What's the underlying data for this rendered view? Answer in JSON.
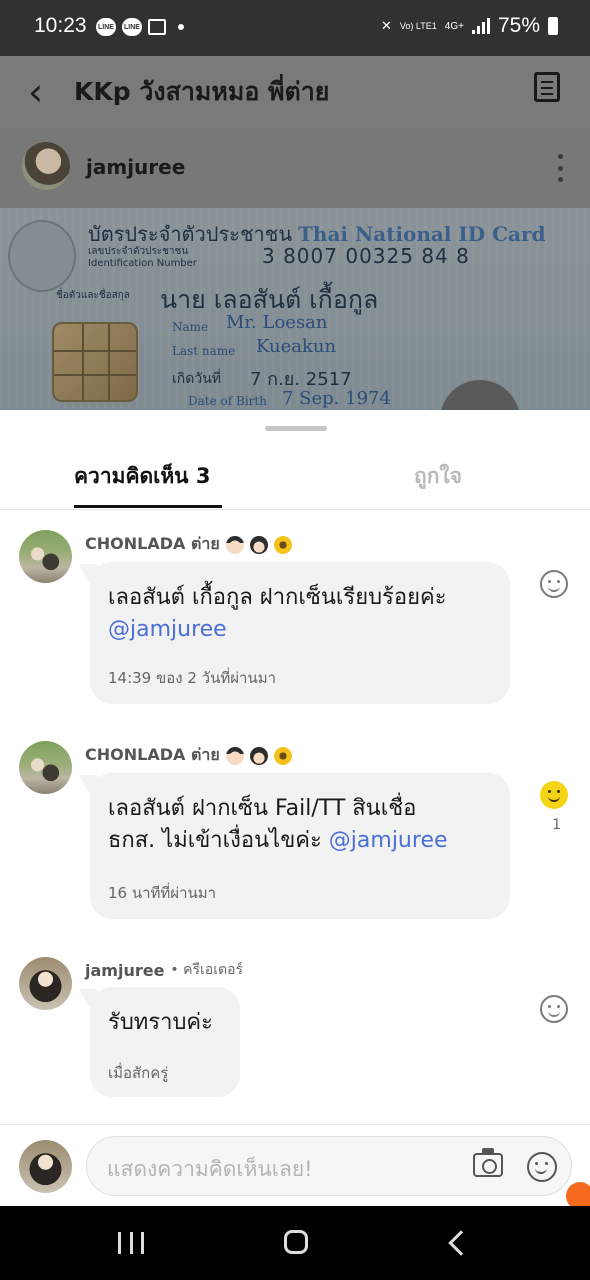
{
  "status_bar": {
    "time": "10:23",
    "notification_icons": [
      "LINE",
      "LINE"
    ],
    "network_label": "Vo) LTE1",
    "network_type": "4G+",
    "battery": "75%"
  },
  "header": {
    "title": "KKp วังสามหมอ พี่ต่าย"
  },
  "post": {
    "username": "jamjuree"
  },
  "id_card": {
    "title_th": "บัตรประจำตัวประชาชน",
    "title_en": "Thai National ID Card",
    "id_label_th": "เลขประจำตัวประชาชน",
    "id_label_en": "Identification Number",
    "id_number": "3 8007 00325 84 8",
    "name_label_th": "ชื่อตัวและชื่อสกุล",
    "name_th": "นาย เลอสันต์ เกื้อกูล",
    "name_label_en": "Name",
    "name_en": "Mr. Loesan",
    "lastname_label_en": "Last name",
    "lastname_en": "Kueakun",
    "dob_label_th": "เกิดวันที่",
    "dob_th": "7 ก.ย. 2517",
    "dob_label_en": "Date of Birth",
    "dob_en": "7 Sep. 1974"
  },
  "sheet": {
    "tabs": [
      {
        "label": "ความคิดเห็น 3",
        "active": true
      },
      {
        "label": "ถูกใจ",
        "active": false
      }
    ]
  },
  "comments": [
    {
      "author": "CHONLADA ต่าย",
      "role": "",
      "text_lines": [
        "เลอสันต์ เกื้อกูล ฝากเซ็นเรียบร้อยค่ะ"
      ],
      "mention": "@jamjuree",
      "time": "14:39 ของ 2 วันที่ผ่านมา",
      "reaction_count": ""
    },
    {
      "author": "CHONLADA ต่าย",
      "role": "",
      "text_lines": [
        "เลอสันต์ ฝากเซ็น Fail/TT สินเชื่อ",
        "ธกส. ไม่เข้าเงื่อนไขค่ะ"
      ],
      "mention": "@jamjuree",
      "time": "16 นาทีที่ผ่านมา",
      "reaction_count": "1"
    },
    {
      "author": "jamjuree",
      "role": "• ครีเอเตอร์",
      "text_lines": [
        "รับทราบค่ะ"
      ],
      "mention": "",
      "time": "เมื่อสักครู่",
      "reaction_count": ""
    }
  ],
  "composer": {
    "placeholder": "แสดงความคิดเห็นเลย!"
  },
  "colors": {
    "mention": "#4a6fd6",
    "reaction_active": "#f5d416",
    "overlay": "#7a7a7a"
  },
  "icons": [
    "back-icon",
    "document-icon",
    "kebab-icon",
    "smile-icon",
    "camera-icon",
    "emoji-icon",
    "recent-apps-icon",
    "home-icon",
    "nav-back-icon"
  ]
}
